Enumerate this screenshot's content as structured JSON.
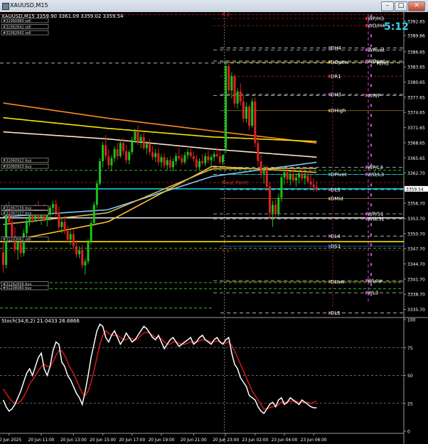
{
  "window": {
    "title": "XAUUSD,M15",
    "minimize": "–",
    "restore": "□",
    "close": "✕"
  },
  "chart_data": {
    "type": "candlestick",
    "symbol": "XAUUSD,M15",
    "ohlc_header": "XAUUSD,M15  3359.90 3361.09 3359.02 3359.54",
    "countdown": "5:12",
    "current_price": 3359.54,
    "y_ticks": [
      3392.65,
      3389.86,
      3386.65,
      3383.65,
      3380.65,
      3377.65,
      3374.65,
      3371.65,
      3368.65,
      3365.65,
      3362.7,
      3359.54,
      3356.7,
      3353.7,
      3350.7,
      3347.7,
      3344.7,
      3341.7,
      3338.7,
      3335.7
    ],
    "ylim": [
      3334.8,
      3394.2
    ],
    "x_ticks": [
      "20 Jun 2025",
      "20 Jun 11:00",
      "20 Jun 13:00",
      "20 Jun 15:00",
      "20 Jun 17:00",
      "20 Jun 19:00",
      "20 Jun 21:00",
      "20 Jun 23:00",
      "23 Jun 02:00",
      "23 Jun 04:00",
      "23 Jun 06:00"
    ],
    "x_tick_idx": [
      2,
      13,
      24,
      34,
      44,
      54,
      65,
      76,
      86,
      96,
      106
    ],
    "candles": [
      [
        3347.0,
        3350.2,
        3343.0,
        3344.5
      ],
      [
        3344.5,
        3356.5,
        3343.8,
        3355.5
      ],
      [
        3355.5,
        3357.0,
        3352.5,
        3353.0
      ],
      [
        3353.0,
        3354.3,
        3349.0,
        3350.2
      ],
      [
        3350.2,
        3352.0,
        3346.8,
        3347.5
      ],
      [
        3347.5,
        3349.8,
        3345.5,
        3349.0
      ],
      [
        3349.0,
        3350.0,
        3346.0,
        3346.8
      ],
      [
        3346.8,
        3351.5,
        3346.2,
        3350.8
      ],
      [
        3350.8,
        3353.8,
        3350.0,
        3353.0
      ],
      [
        3353.0,
        3355.8,
        3352.2,
        3355.0
      ],
      [
        3355.0,
        3356.2,
        3352.8,
        3353.5
      ],
      [
        3353.5,
        3356.5,
        3353.0,
        3356.0
      ],
      [
        3356.0,
        3357.2,
        3353.2,
        3353.8
      ],
      [
        3353.8,
        3356.0,
        3352.4,
        3355.2
      ],
      [
        3355.2,
        3356.6,
        3353.0,
        3353.4
      ],
      [
        3353.4,
        3355.2,
        3352.1,
        3354.6
      ],
      [
        3354.6,
        3356.3,
        3353.2,
        3355.8
      ],
      [
        3355.8,
        3357.2,
        3354.4,
        3356.5
      ],
      [
        3356.5,
        3357.4,
        3354.0,
        3354.8
      ],
      [
        3354.8,
        3356.0,
        3351.4,
        3352.0
      ],
      [
        3352.0,
        3353.6,
        3350.8,
        3353.0
      ],
      [
        3353.0,
        3354.2,
        3350.6,
        3351.2
      ],
      [
        3351.2,
        3352.3,
        3348.8,
        3349.5
      ],
      [
        3349.5,
        3351.2,
        3348.4,
        3350.6
      ],
      [
        3350.6,
        3351.4,
        3347.6,
        3348.2
      ],
      [
        3348.2,
        3349.4,
        3346.0,
        3346.6
      ],
      [
        3346.6,
        3348.2,
        3345.8,
        3347.4
      ],
      [
        3347.4,
        3348.5,
        3343.8,
        3344.4
      ],
      [
        3344.4,
        3345.8,
        3342.6,
        3345.2
      ],
      [
        3345.2,
        3349.6,
        3344.6,
        3349.0
      ],
      [
        3349.0,
        3353.4,
        3348.6,
        3352.8
      ],
      [
        3352.8,
        3357.0,
        3352.2,
        3356.4
      ],
      [
        3356.4,
        3361.2,
        3355.8,
        3360.6
      ],
      [
        3360.6,
        3365.6,
        3360.2,
        3365.0
      ],
      [
        3365.0,
        3368.8,
        3363.8,
        3368.2
      ],
      [
        3368.2,
        3370.2,
        3365.4,
        3366.0
      ],
      [
        3366.0,
        3367.4,
        3363.4,
        3364.2
      ],
      [
        3364.2,
        3366.2,
        3363.0,
        3365.6
      ],
      [
        3365.6,
        3368.0,
        3364.8,
        3367.4
      ],
      [
        3367.4,
        3368.6,
        3365.2,
        3366.0
      ],
      [
        3366.0,
        3369.2,
        3365.6,
        3368.6
      ],
      [
        3368.6,
        3369.6,
        3366.2,
        3367.0
      ],
      [
        3367.0,
        3368.2,
        3364.6,
        3365.2
      ],
      [
        3365.2,
        3367.2,
        3364.4,
        3366.8
      ],
      [
        3366.8,
        3369.8,
        3366.2,
        3369.2
      ],
      [
        3369.2,
        3371.4,
        3368.6,
        3370.8
      ],
      [
        3370.8,
        3372.0,
        3368.2,
        3368.8
      ],
      [
        3368.8,
        3370.4,
        3367.6,
        3369.8
      ],
      [
        3369.8,
        3370.6,
        3367.2,
        3367.6
      ],
      [
        3367.6,
        3369.0,
        3366.4,
        3368.4
      ],
      [
        3368.4,
        3369.4,
        3366.2,
        3366.8
      ],
      [
        3366.8,
        3368.0,
        3365.2,
        3365.8
      ],
      [
        3365.8,
        3367.4,
        3364.8,
        3366.6
      ],
      [
        3366.6,
        3367.6,
        3364.2,
        3364.8
      ],
      [
        3364.8,
        3366.4,
        3363.8,
        3365.8
      ],
      [
        3365.8,
        3366.6,
        3363.6,
        3364.2
      ],
      [
        3364.2,
        3365.8,
        3363.2,
        3365.2
      ],
      [
        3365.2,
        3366.0,
        3363.4,
        3363.8
      ],
      [
        3363.8,
        3365.6,
        3363.0,
        3365.0
      ],
      [
        3365.0,
        3366.6,
        3364.2,
        3366.0
      ],
      [
        3366.0,
        3367.6,
        3365.2,
        3365.6
      ],
      [
        3365.6,
        3366.4,
        3364.2,
        3364.8
      ],
      [
        3364.8,
        3366.8,
        3364.4,
        3366.2
      ],
      [
        3366.2,
        3367.4,
        3365.4,
        3366.8
      ],
      [
        3366.8,
        3367.8,
        3365.6,
        3366.0
      ],
      [
        3366.0,
        3367.0,
        3364.8,
        3365.4
      ],
      [
        3365.4,
        3366.2,
        3363.4,
        3363.8
      ],
      [
        3363.8,
        3365.6,
        3363.2,
        3365.0
      ],
      [
        3365.0,
        3366.4,
        3364.2,
        3364.6
      ],
      [
        3364.6,
        3366.6,
        3364.0,
        3366.0
      ],
      [
        3366.0,
        3367.2,
        3364.6,
        3365.2
      ],
      [
        3365.2,
        3366.4,
        3364.0,
        3365.8
      ],
      [
        3365.8,
        3367.0,
        3365.0,
        3366.4
      ],
      [
        3366.4,
        3367.6,
        3365.6,
        3366.0
      ],
      [
        3366.0,
        3367.2,
        3364.4,
        3364.8
      ],
      [
        3364.8,
        3366.4,
        3364.2,
        3366.2
      ],
      [
        3367.5,
        3385.0,
        3366.5,
        3383.8
      ],
      [
        3383.8,
        3384.8,
        3378.0,
        3379.0
      ],
      [
        3379.0,
        3382.6,
        3377.4,
        3381.8
      ],
      [
        3381.8,
        3382.2,
        3375.6,
        3376.4
      ],
      [
        3376.4,
        3379.4,
        3375.4,
        3378.8
      ],
      [
        3378.8,
        3380.4,
        3376.0,
        3376.8
      ],
      [
        3376.8,
        3378.2,
        3372.6,
        3373.4
      ],
      [
        3373.4,
        3376.6,
        3372.6,
        3375.8
      ],
      [
        3375.8,
        3376.2,
        3371.2,
        3372.0
      ],
      [
        3372.0,
        3377.4,
        3371.6,
        3376.8
      ],
      [
        3376.8,
        3377.6,
        3367.8,
        3368.6
      ],
      [
        3368.6,
        3369.8,
        3364.0,
        3365.0
      ],
      [
        3365.0,
        3366.4,
        3361.6,
        3362.6
      ],
      [
        3362.6,
        3364.2,
        3360.6,
        3363.4
      ],
      [
        3363.4,
        3364.2,
        3359.2,
        3360.0
      ],
      [
        3360.0,
        3360.8,
        3353.6,
        3354.8
      ],
      [
        3354.8,
        3357.2,
        3352.0,
        3356.4
      ],
      [
        3356.4,
        3357.4,
        3353.6,
        3354.6
      ],
      [
        3354.6,
        3358.6,
        3354.0,
        3357.8
      ],
      [
        3357.8,
        3362.4,
        3357.0,
        3361.8
      ],
      [
        3361.8,
        3364.0,
        3360.4,
        3362.8
      ],
      [
        3362.8,
        3363.6,
        3360.6,
        3361.4
      ],
      [
        3361.4,
        3363.0,
        3360.2,
        3362.4
      ],
      [
        3362.4,
        3363.4,
        3360.8,
        3361.2
      ],
      [
        3361.2,
        3362.6,
        3360.0,
        3361.8
      ],
      [
        3361.8,
        3363.2,
        3360.6,
        3362.6
      ],
      [
        3362.6,
        3363.6,
        3361.0,
        3361.6
      ],
      [
        3361.6,
        3362.8,
        3360.4,
        3362.2
      ],
      [
        3362.2,
        3363.0,
        3360.6,
        3361.0
      ],
      [
        3361.0,
        3362.4,
        3359.6,
        3360.4
      ],
      [
        3360.4,
        3361.6,
        3359.0,
        3359.9
      ],
      [
        3359.9,
        3361.09,
        3359.02,
        3359.54
      ]
    ],
    "moving_averages": [
      {
        "color": "#ff8a1e",
        "values": [
          3376.5,
          3373.5,
          3371.0,
          3368.6
        ]
      },
      {
        "color": "#f5e600",
        "values": [
          3373.6,
          3371.5,
          3369.8,
          3368.9
        ]
      },
      {
        "color": "#ffe3c4",
        "values": [
          3370.8,
          3369.4,
          3367.4,
          3365.8
        ]
      },
      {
        "color": "#7ec8ee",
        "values": [
          3354.0,
          3355.4,
          3362.0,
          3364.8
        ]
      },
      {
        "color": "#ffc22c",
        "values": [
          3349.0,
          3353.0,
          3364.0,
          3362.8
        ]
      },
      {
        "color": "#d4b55c",
        "values": [
          3352.5,
          3354.8,
          3363.5,
          3363.6
        ]
      }
    ],
    "levels": [
      {
        "label": "WP/H3",
        "value": 3393.2,
        "color": "#dd2a2a"
      },
      {
        "label": "WO/H4",
        "value": 3391.8,
        "color": "#dd2a2a"
      },
      {
        "label": "DH4",
        "value": 3387.4,
        "color": "#ffffff"
      },
      {
        "label": "WPivot",
        "value": 3387.0,
        "color": "#ffffff"
      },
      {
        "label": "DOpen",
        "value": 3384.6,
        "color": "#e8d038"
      },
      {
        "label": "WOpen",
        "value": 3384.8,
        "color": "#ffffff"
      },
      {
        "label": "R/H3",
        "value": 3384.4,
        "color": "#ffffff"
      },
      {
        "label": "DR1",
        "value": 3381.8,
        "color": "#dd2a2a"
      },
      {
        "label": "DH3",
        "value": 3378.2,
        "color": "#ffffff"
      },
      {
        "label": "WR/P",
        "value": 3378.0,
        "color": "#ffffff"
      },
      {
        "label": "DHigh",
        "value": 3375.0,
        "color": "#cf9a20"
      },
      {
        "label": "WP/L3",
        "value": 3363.8,
        "color": "#ffffff"
      },
      {
        "label": "WO/L3",
        "value": 3362.4,
        "color": "#ffffff"
      },
      {
        "label": "DPivot",
        "value": 3362.4,
        "color": "#00c0c8"
      },
      {
        "label": "Pivot Point",
        "value": 3360.8,
        "color": "#dd2a2a"
      },
      {
        "label": "DL3",
        "value": 3359.4,
        "color": "#ffffff"
      },
      {
        "label": "DMid",
        "value": 3357.6,
        "color": "#cf9a20"
      },
      {
        "label": "WP/S1",
        "value": 3354.6,
        "color": "#ffffff"
      },
      {
        "label": "WO/S1",
        "value": 3353.6,
        "color": "#ffffff"
      },
      {
        "label": "DL4",
        "value": 3350.2,
        "color": "#ffffff"
      },
      {
        "label": "DS1",
        "value": 3348.2,
        "color": "#3c5cff"
      },
      {
        "label": "S 1",
        "value": 3347.4,
        "color": "#dd2a2a"
      },
      {
        "label": "DLow",
        "value": 3341.2,
        "color": "#aa8820"
      },
      {
        "label": "WLow",
        "value": 3341.4,
        "color": "#ffffff"
      },
      {
        "label": "WL3",
        "value": 3339.0,
        "color": "#ffffff"
      },
      {
        "label": "DL5",
        "value": 3335.0,
        "color": "#ffffff"
      },
      {
        "label": "R 2",
        "value": 3394.0,
        "color": "#dd2a2a"
      }
    ],
    "left_tags": [
      "#31060980 sell",
      "#31062641 sell",
      "#31062642 sell",
      "#31060922 buy",
      "#31060923 buy",
      "#31067156 buy",
      "#31067157 buy",
      "#31262056 buy",
      "#31203062 sell",
      "#31208080 buy"
    ],
    "stochastic": {
      "title": "Stoch(34,6,2) 21.0433 26.6866",
      "ylim": [
        0,
        100
      ],
      "y_ticks": [
        100,
        75,
        50,
        25,
        0
      ],
      "main_color": "#ffffff",
      "signal_color": "#d21818",
      "main": [
        28,
        22,
        18,
        20,
        24,
        30,
        36,
        44,
        52,
        56,
        50,
        58,
        66,
        70,
        56,
        50,
        58,
        72,
        80,
        78,
        62,
        58,
        50,
        46,
        40,
        34,
        30,
        24,
        36,
        50,
        66,
        78,
        90,
        96,
        94,
        84,
        80,
        86,
        90,
        84,
        78,
        82,
        88,
        84,
        80,
        82,
        86,
        90,
        94,
        92,
        88,
        84,
        82,
        86,
        80,
        74,
        78,
        82,
        84,
        80,
        76,
        78,
        80,
        82,
        84,
        78,
        80,
        84,
        86,
        82,
        80,
        78,
        82,
        84,
        80,
        78,
        82,
        84,
        70,
        60,
        56,
        48,
        44,
        40,
        32,
        30,
        28,
        22,
        18,
        16,
        20,
        24,
        26,
        22,
        28,
        30,
        24,
        26,
        30,
        28,
        26,
        24,
        28,
        26,
        24,
        22,
        21,
        21
      ],
      "signal": [
        38,
        34,
        30,
        27,
        25,
        25,
        27,
        31,
        36,
        42,
        46,
        50,
        54,
        58,
        60,
        58,
        58,
        62,
        68,
        72,
        72,
        68,
        62,
        56,
        52,
        46,
        40,
        34,
        32,
        36,
        44,
        54,
        66,
        78,
        86,
        90,
        88,
        86,
        86,
        86,
        84,
        82,
        82,
        84,
        83,
        82,
        83,
        86,
        88,
        89,
        88,
        86,
        84,
        84,
        83,
        80,
        78,
        78,
        80,
        80,
        79,
        78,
        78,
        79,
        80,
        80,
        80,
        81,
        82,
        82,
        81,
        80,
        80,
        81,
        80,
        79,
        79,
        80,
        77,
        72,
        66,
        60,
        54,
        48,
        42,
        36,
        32,
        28,
        24,
        20,
        20,
        21,
        22,
        22,
        24,
        26,
        26,
        26,
        27,
        27,
        27,
        26,
        26,
        26,
        26,
        25,
        26,
        27
      ]
    }
  }
}
